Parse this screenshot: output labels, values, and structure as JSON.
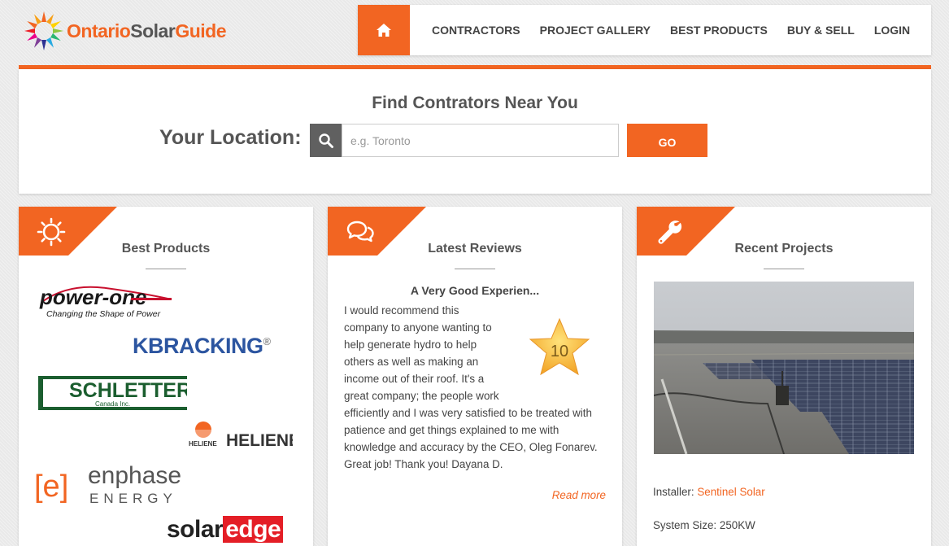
{
  "brand": {
    "part1": "Ontario",
    "part2": "Solar",
    "part3": "Guide",
    "accent": "#f26522"
  },
  "nav": {
    "home_icon": "home-icon",
    "items": [
      "CONTRACTORS",
      "PROJECT GALLERY",
      "BEST PRODUCTS",
      "BUY & SELL",
      "LOGIN"
    ]
  },
  "search": {
    "title": "Find Contrators Near You",
    "label": "Your Location:",
    "placeholder": "e.g. Toronto",
    "value": "",
    "button": "GO",
    "icon": "search-icon"
  },
  "products": {
    "title": "Best Products",
    "icon": "sun-icon",
    "logos": {
      "power_one": "power-one",
      "power_one_tagline": "Changing the Shape of Power",
      "kb_racking": "KBRACKING",
      "schletter": "SCHLETTER",
      "schletter_sub": "Canada Inc.",
      "heliene": "HELIENE",
      "enphase_bracket": "[e]",
      "enphase": "enphase",
      "enphase_sub": "ENERGY",
      "solaredge_a": "solar",
      "solaredge_b": "edge"
    }
  },
  "reviews": {
    "title": "Latest Reviews",
    "icon": "chat-bubbles-icon",
    "item_title": "A Very Good Experien...",
    "score": "10",
    "body_lines": [
      "I would recommend this",
      "company to anyone wanting to",
      "help generate hydro to help",
      "others as well as making an",
      "income out of their roof. It's a",
      "great company; the people work"
    ],
    "body_rest": "efficiently and I was very satisfied to be treated with patience and get things explained to me with knowledge and accuracy by the CEO, Oleg Fonarev. Great job! Thank you! Dayana D.",
    "read_more": "Read more"
  },
  "projects": {
    "title": "Recent Projects",
    "icon": "wrench-icon",
    "installer_label": "Installer:",
    "installer_name": "Sentinel Solar",
    "size_label": "System Size:",
    "size_value": "250KW"
  }
}
